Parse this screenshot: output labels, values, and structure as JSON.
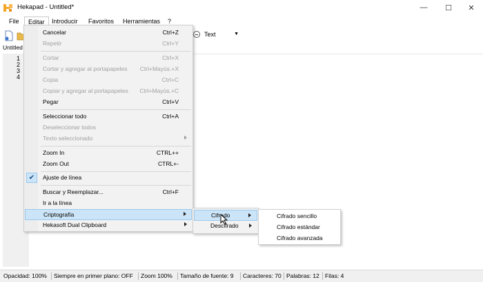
{
  "window": {
    "title": "Hekapad - Untitled*",
    "controls": {
      "minimize": "—",
      "maximize": "☐",
      "close": "✕"
    }
  },
  "menubar": [
    "File",
    "Editar",
    "Introducir",
    "Favoritos",
    "Herramientas",
    "?"
  ],
  "toolbar": {
    "text_combo_value": "Text"
  },
  "doc_tab": "Untitled",
  "line_numbers": [
    "1",
    "2",
    "3",
    "4"
  ],
  "edit_menu": [
    {
      "label": "Cancelar",
      "shortcut": "Ctrl+Z",
      "enabled": true
    },
    {
      "label": "Repetir",
      "shortcut": "Ctrl+Y",
      "enabled": false
    },
    {
      "label": "Cortar",
      "shortcut": "Ctrl+X",
      "enabled": false
    },
    {
      "label": "Cortar y agregar al portapapeles",
      "shortcut": "Ctrl+Mayús.+X",
      "enabled": false
    },
    {
      "label": "Copia",
      "shortcut": "Ctrl+C",
      "enabled": false
    },
    {
      "label": "Copiar y agregar al portapapeles",
      "shortcut": "Ctrl+Mayús.+C",
      "enabled": false
    },
    {
      "label": "Pegar",
      "shortcut": "Ctrl+V",
      "enabled": true
    },
    {
      "label": "Seleccionar todo",
      "shortcut": "Ctrl+A",
      "enabled": true
    },
    {
      "label": "Deseleccionar todos",
      "shortcut": "",
      "enabled": false
    },
    {
      "label": "Texto seleccionado",
      "shortcut": "",
      "enabled": false,
      "submenu": true
    },
    {
      "label": "Zoom In",
      "shortcut": "CTRL++",
      "enabled": true
    },
    {
      "label": "Zoom Out",
      "shortcut": "CTRL+-",
      "enabled": true
    },
    {
      "label": "Ajuste de línea",
      "shortcut": "",
      "enabled": true,
      "checked": true
    },
    {
      "label": "Buscar y Reemplazar...",
      "shortcut": "Ctrl+F",
      "enabled": true
    },
    {
      "label": "Ir a la línea",
      "shortcut": "",
      "enabled": true
    },
    {
      "label": "Criptografía",
      "shortcut": "",
      "enabled": true,
      "submenu": true,
      "highlighted": true
    },
    {
      "label": "Hekasoft Dual Clipboard",
      "shortcut": "",
      "enabled": true,
      "submenu": true
    }
  ],
  "crypto_submenu": [
    {
      "label": "Cifrado",
      "highlighted": true
    },
    {
      "label": "Descifrado",
      "highlighted": false
    }
  ],
  "cipher_submenu": [
    "Cifrado sencillo",
    "Cifrado estándar",
    "Cifrado avanzada"
  ],
  "statusbar": [
    "Opacidad:  100%",
    "Siempre en primer plano:  OFF",
    "Zoom   100%",
    "Tamaño de fuente:   9",
    "Caracteres:   70",
    "Palabras:   12",
    "Filas:   4"
  ],
  "colors": {
    "highlight": "#cce4f7",
    "highlight_border": "#99c9ef",
    "disabled_text": "#a0a0a0",
    "logo": "#f5a623"
  }
}
